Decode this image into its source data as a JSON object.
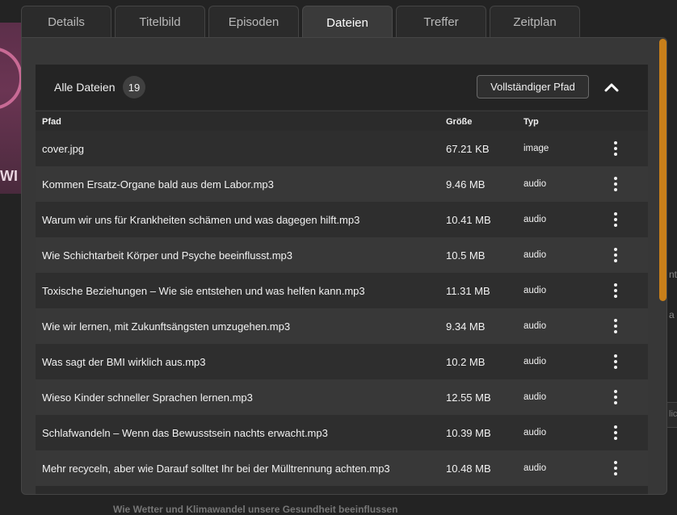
{
  "tabs": [
    {
      "label": "Details"
    },
    {
      "label": "Titelbild"
    },
    {
      "label": "Episoden"
    },
    {
      "label": "Dateien",
      "active": true
    },
    {
      "label": "Treffer"
    },
    {
      "label": "Zeitplan"
    }
  ],
  "background": {
    "cover_fragment": "WI",
    "side_text_1": "nt",
    "side_text_2": "a",
    "side_text_3": "lich",
    "bottom_text": "Wie Wetter und Klimawandel unsere Gesundheit beeinflussen"
  },
  "files": {
    "header_title": "Alle Dateien",
    "count": "19",
    "full_path_button": "Vollständiger Pfad",
    "columns": {
      "path": "Pfad",
      "size": "Größe",
      "type": "Typ"
    },
    "rows": [
      {
        "path": "cover.jpg",
        "size": "67.21 KB",
        "type": "image"
      },
      {
        "path": "Kommen Ersatz-Organe bald aus dem Labor.mp3",
        "size": "9.46 MB",
        "type": "audio"
      },
      {
        "path": "Warum wir uns für Krankheiten schämen und was dagegen hilft.mp3",
        "size": "10.41 MB",
        "type": "audio"
      },
      {
        "path": "Wie Schichtarbeit Körper und Psyche beeinflusst.mp3",
        "size": "10.5 MB",
        "type": "audio"
      },
      {
        "path": "Toxische Beziehungen – Wie sie entstehen und was helfen kann.mp3",
        "size": "11.31 MB",
        "type": "audio"
      },
      {
        "path": "Wie wir lernen, mit Zukunftsängsten umzugehen.mp3",
        "size": "9.34 MB",
        "type": "audio"
      },
      {
        "path": "Was sagt der BMI wirklich aus.mp3",
        "size": "10.2 MB",
        "type": "audio"
      },
      {
        "path": "Wieso Kinder schneller Sprachen lernen.mp3",
        "size": "12.55 MB",
        "type": "audio"
      },
      {
        "path": "Schlafwandeln – Wenn das Bewusstsein nachts erwacht.mp3",
        "size": "10.39 MB",
        "type": "audio"
      },
      {
        "path": "Mehr recyceln, aber wie Darauf solltet Ihr bei der Mülltrennung achten.mp3",
        "size": "10.48 MB",
        "type": "audio"
      }
    ]
  },
  "colors": {
    "accent_scrollbar": "#c87f1a"
  },
  "icons": {
    "collapse": "chevron-up-icon",
    "row_menu": "more-vertical-icon"
  }
}
